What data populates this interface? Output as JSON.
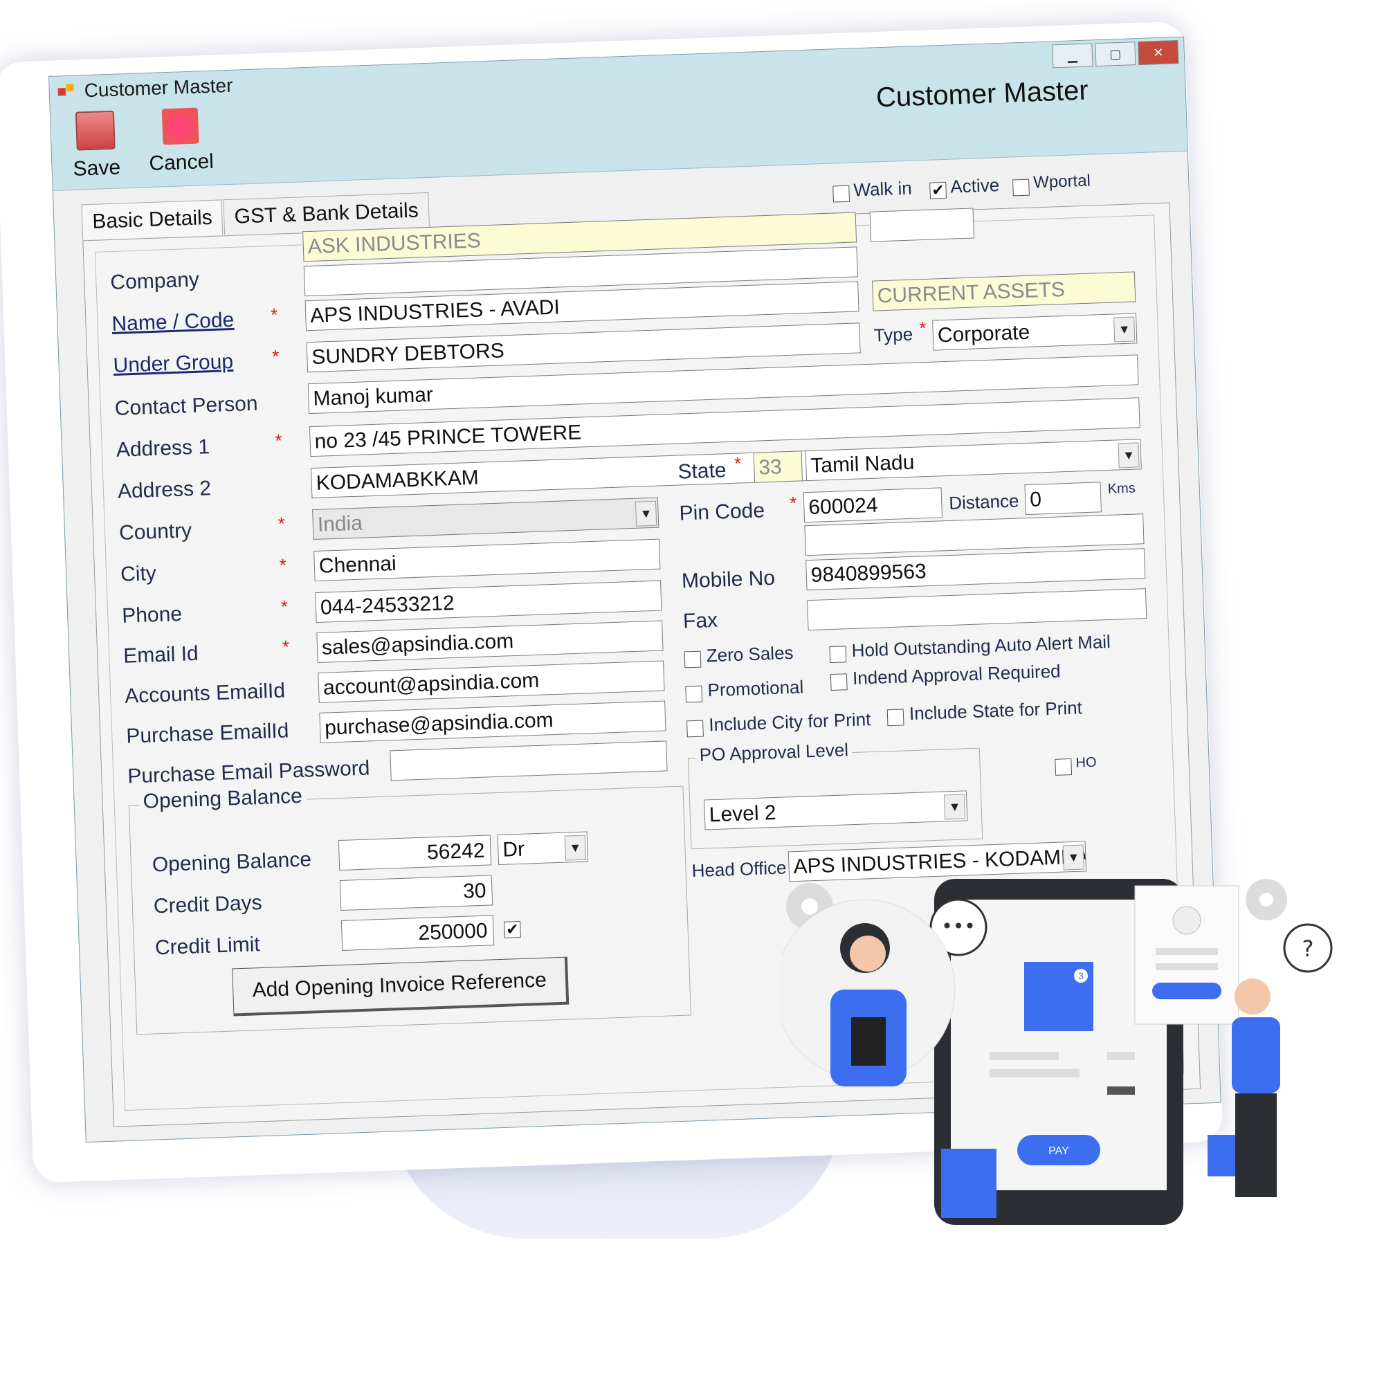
{
  "window": {
    "title": "Customer Master",
    "header_title": "Customer Master",
    "controls": [
      "▁",
      "▢",
      "✕"
    ]
  },
  "toolbar": {
    "save_label": "Save",
    "cancel_label": "Cancel"
  },
  "tabs": [
    {
      "label": "Basic Details"
    },
    {
      "label": "GST & Bank Details"
    }
  ],
  "flags": {
    "walk_in": {
      "label": "Walk in",
      "checked": false
    },
    "active": {
      "label": "Active",
      "checked": true
    },
    "wportal": {
      "label": "Wportal",
      "checked": false
    }
  },
  "form": {
    "company": {
      "label": "Company",
      "value": "ASK INDUSTRIES"
    },
    "name_code": {
      "label": "Name / Code",
      "value": "APS INDUSTRIES - AVADI",
      "code": "",
      "group_type": "CURRENT ASSETS"
    },
    "under_group": {
      "label": "Under Group",
      "value": "SUNDRY DEBTORS"
    },
    "type": {
      "label": "Type",
      "value": "Corporate"
    },
    "contact_person": {
      "label": "Contact Person",
      "value": "Manoj kumar"
    },
    "address1": {
      "label": "Address 1",
      "value": "no 23 /45 PRINCE TOWERE"
    },
    "address2": {
      "label": "Address 2",
      "value": "KODAMABKKAM"
    },
    "state": {
      "label": "State",
      "code": "33",
      "value": "Tamil Nadu"
    },
    "country": {
      "label": "Country",
      "value": "India"
    },
    "pin_code": {
      "label": "Pin Code",
      "value": "600024"
    },
    "distance": {
      "label": "Distance",
      "value": "0",
      "unit": "Kms"
    },
    "city": {
      "label": "City",
      "value": "Chennai"
    },
    "mobile": {
      "label": "Mobile No",
      "value": "9840899563"
    },
    "phone": {
      "label": "Phone",
      "value": "044-24533212"
    },
    "fax": {
      "label": "Fax",
      "value": ""
    },
    "email": {
      "label": "Email Id",
      "value": "sales@apsindia.com"
    },
    "accounts_email": {
      "label": "Accounts EmailId",
      "value": "account@apsindia.com"
    },
    "purchase_email": {
      "label": "Purchase EmailId",
      "value": "purchase@apsindia.com"
    },
    "purchase_email_password": {
      "label": "Purchase Email Password",
      "value": ""
    }
  },
  "options": {
    "zero_sales": "Zero Sales",
    "hold_outstanding": "Hold Outstanding Auto Alert Mail",
    "indend_approval": "Indend Approval Required",
    "promotional": "Promotional",
    "include_state": "Include State for Print",
    "include_city": "Include City for Print"
  },
  "po_approval": {
    "title": "PO Approval Level",
    "value": "Level 2"
  },
  "head_office": {
    "label": "Head Office",
    "value": "APS INDUSTRIES - KODAMBAKKA",
    "ho_label": "HO"
  },
  "opening": {
    "group_title": "Opening Balance",
    "balance_label": "Opening Balance",
    "balance_value": "56242",
    "drcr": "Dr",
    "credit_days_label": "Credit Days",
    "credit_days_value": "30",
    "credit_limit_label": "Credit Limit",
    "credit_limit_value": "250000",
    "add_invoice_label": "Add Opening Invoice Reference"
  },
  "illustration": {
    "pay_label": "PAY",
    "question": "?",
    "chat": "•••",
    "cart_badge": "3"
  },
  "colors": {
    "accent": "#3d6ef0",
    "titlebar": "#c9e3ea",
    "required": "#d21b1b"
  }
}
